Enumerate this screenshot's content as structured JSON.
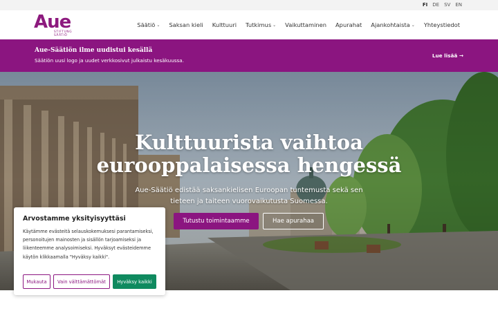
{
  "languages": [
    {
      "code": "FI",
      "active": true
    },
    {
      "code": "DE",
      "active": false
    },
    {
      "code": "SV",
      "active": false
    },
    {
      "code": "EN",
      "active": false
    }
  ],
  "logo": {
    "main": "Aue",
    "sub_line1": "STIFTUNG",
    "sub_line2": "SÄÄTIÖ"
  },
  "nav": [
    {
      "label": "Säätiö",
      "dropdown": true
    },
    {
      "label": "Saksan kieli",
      "dropdown": false
    },
    {
      "label": "Kulttuuri",
      "dropdown": false
    },
    {
      "label": "Tutkimus",
      "dropdown": true
    },
    {
      "label": "Vaikuttaminen",
      "dropdown": false
    },
    {
      "label": "Apurahat",
      "dropdown": false
    },
    {
      "label": "Ajankohtaista",
      "dropdown": true
    },
    {
      "label": "Yhteystiedot",
      "dropdown": false
    }
  ],
  "announcement": {
    "title": "Aue-Säätiön ilme uudistui kesällä",
    "text": "Säätiön uusi logo ja uudet verkkosivut julkaistu kesäkuussa.",
    "link": "Lue lisää →"
  },
  "hero": {
    "title_line1": "Kulttuurista vaihtoa",
    "title_line2": "eurooppalaisessa hengessä",
    "subtitle_line1": "Aue-Säätiö edistää saksankielisen Euroopan tuntemusta sekä sen",
    "subtitle_line2": "tieteen ja taiteen vuorovaikutusta Suomessa.",
    "primary_button": "Tutustu toimintaamme",
    "secondary_button": "Hae apurahaa"
  },
  "cookie": {
    "title": "Arvostamme yksityisyyttäsi",
    "text": "Käytämme evästeitä selauskokemuksesi parantamiseksi, personoitujen mainosten ja sisällön tarjoamiseksi ja liikenteemme analysoimiseksi. Hyväksyt evästeidemme käytön klikkaamalla \"Hyväksy kaikki\".",
    "customize": "Mukauta",
    "necessary": "Vain välttämättömät",
    "accept_all": "Hyväksy kaikki"
  },
  "colors": {
    "brand": "#8b1580",
    "accept": "#0f8a5f"
  }
}
